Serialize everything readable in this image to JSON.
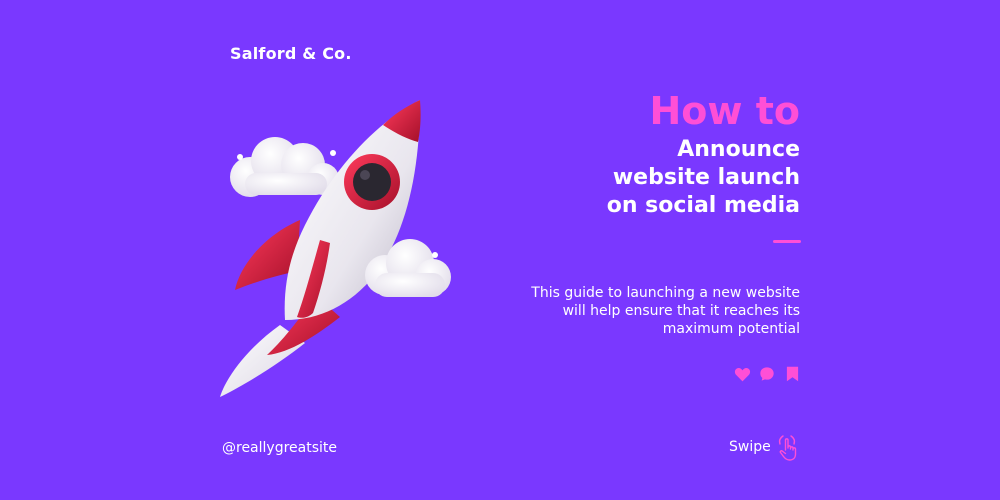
{
  "brand": {
    "name": "Salford & Co."
  },
  "headline": {
    "lead": "How to",
    "lines": [
      "Announce",
      "website launch",
      "on social media"
    ]
  },
  "description": {
    "lines": [
      "This guide to launching a new website",
      "will help ensure that it reaches its",
      "maximum potential"
    ]
  },
  "actions": [
    {
      "icon": "heart-icon"
    },
    {
      "icon": "comment-icon"
    },
    {
      "icon": "bookmark-icon"
    }
  ],
  "footer": {
    "handle": "@reallygreatsite",
    "swipe_label": "Swipe",
    "swipe_icon": "hand-swipe-icon"
  },
  "colors": {
    "background": "#7a38ff",
    "accent": "#ff4fd6",
    "text": "#ffffff",
    "rocket_red": "#d11a3c"
  }
}
